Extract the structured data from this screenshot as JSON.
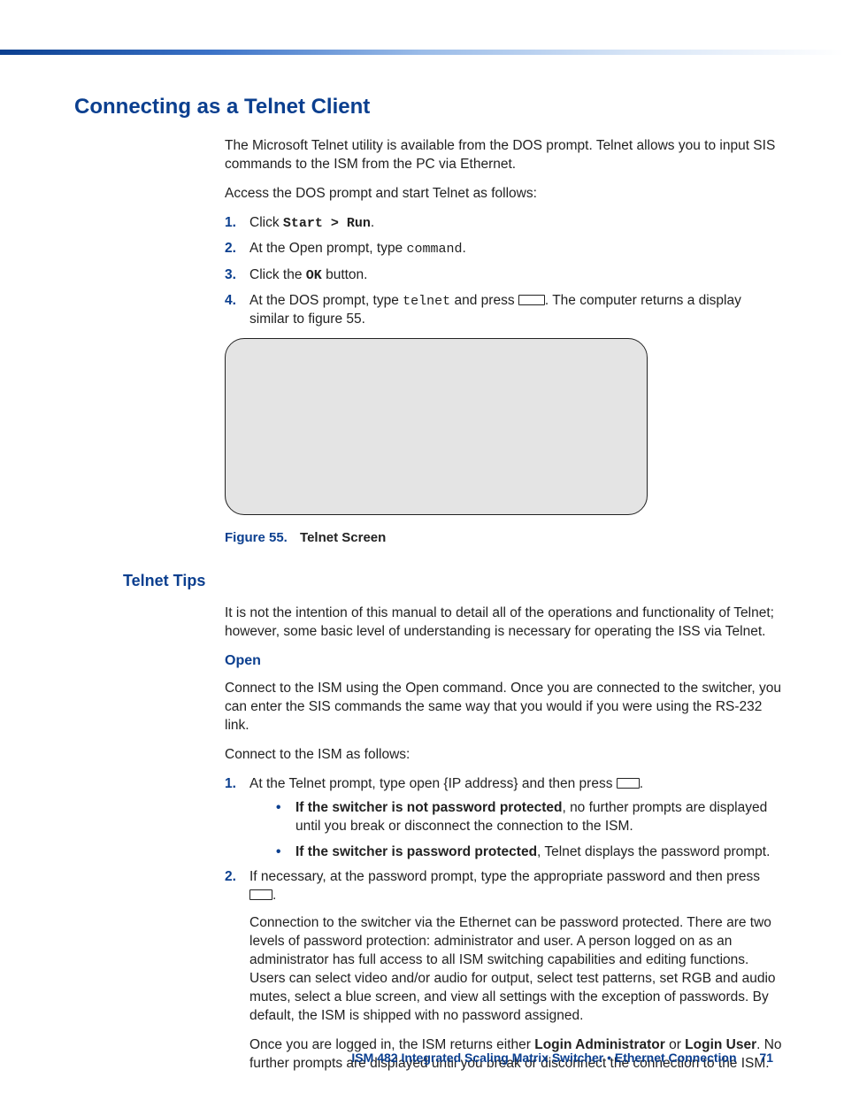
{
  "heading": "Connecting as a Telnet Client",
  "intro1": "The Microsoft Telnet utility is available from the DOS prompt. Telnet allows you to input SIS commands to the ISM from the PC via Ethernet.",
  "intro2": "Access the DOS prompt and start Telnet as follows:",
  "steps": {
    "n1": "1.",
    "s1_a": "Click ",
    "s1_b": "Start > Run",
    "s1_c": ".",
    "n2": "2.",
    "s2_a": "At the Open prompt, type ",
    "s2_b": "command",
    "s2_c": ".",
    "n3": "3.",
    "s3_a": "Click the ",
    "s3_b": "OK",
    "s3_c": " button.",
    "n4": "4.",
    "s4_a": "At the DOS prompt, type ",
    "s4_b": "telnet",
    "s4_c": " and press ",
    "s4_d": ". The computer returns a display similar to figure 55."
  },
  "figure": {
    "label": "Figure 55.",
    "caption": "Telnet Screen"
  },
  "tips_heading": "Telnet Tips",
  "tips_intro": "It is not the intention of this manual to detail all of the operations and functionality of Telnet; however, some basic level of understanding is necessary for operating the ISS via Telnet.",
  "open_heading": "Open",
  "open_p1": "Connect to the ISM using the Open command. Once you are connected to the switcher, you can enter the SIS commands the same way that you would if you were using the RS-232 link.",
  "open_p2": "Connect to the ISM as follows:",
  "open_steps": {
    "n1": "1.",
    "s1_a": "At the Telnet prompt, type open {IP address} and then press ",
    "s1_b": ".",
    "b1_bold": "If the switcher is not password protected",
    "b1_rest": ", no further prompts are displayed until you break or disconnect the connection to the ISM.",
    "b2_bold": "If the switcher is password protected",
    "b2_rest": ", Telnet displays the password prompt.",
    "n2": "2.",
    "s2_a": "If necessary, at the password prompt, type the appropriate password and then press ",
    "s2_b": ".",
    "s2_p2": "Connection to the switcher via the Ethernet can be password protected. There are two levels of password protection: administrator and user. A person logged on as an administrator has full access to all ISM switching capabilities and editing functions. Users can select video and/or audio for output, select test patterns, set RGB and audio mutes, select a blue screen, and view all settings with the exception of passwords. By default, the ISM is shipped with no password assigned.",
    "s2_p3_a": "Once you are logged in, the ISM returns either ",
    "s2_p3_b": "Login Administrator",
    "s2_p3_c": " or ",
    "s2_p3_d": "Login User",
    "s2_p3_e": ". No further prompts are displayed until you break or disconnect the connection to the ISM."
  },
  "footer": {
    "title": "ISM 482 Integrated Scaling Matrix Switcher • Ethernet Connection",
    "page": "71"
  }
}
